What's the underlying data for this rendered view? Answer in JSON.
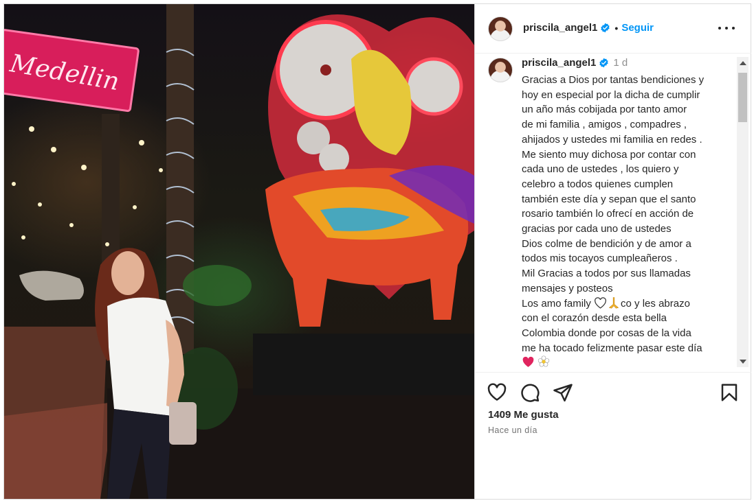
{
  "post": {
    "username": "priscila_angel1",
    "follow_label": "Seguir",
    "separator": "•",
    "photo_sign_text": "Medellin"
  },
  "caption": {
    "username": "priscila_angel1",
    "time": "1 d",
    "lines": [
      "Gracias a Dios por tantas bendiciones y",
      "hoy en especial por la dicha de cumplir",
      "un año más cobijada por tanto amor",
      "de mi familia , amigos , compadres ,",
      "ahijados y ustedes mi familia en redes .",
      "Me siento muy dichosa por contar con",
      "cada uno de ustedes , los quiero y",
      "celebro a todos quienes cumplen",
      "también este día y sepan que el santo",
      "rosario también lo ofrecí en acción de",
      "gracias por cada uno de ustedes",
      "Dios colme de bendición y de amor a",
      "todos mis tocayos cumpleañeros .",
      "Mil Gracias a todos por sus llamadas",
      "mensajes y posteos"
    ],
    "line_family_prefix": "Los amo family",
    "line_family_suffix": "co y les abrazo",
    "lines_end": [
      "con el corazón desde esta bella",
      "Colombia donde por cosas de la vida",
      "me ha tocado felizmente pasar este día"
    ],
    "emojis": [
      "white-heart",
      "folded-hands",
      "red-heart",
      "flower"
    ]
  },
  "stats": {
    "likes": "1409 Me gusta",
    "posted": "Hace un día"
  },
  "icons": {
    "verified": "verified-badge-icon",
    "like": "heart-icon",
    "comment": "comment-icon",
    "share": "share-icon",
    "save": "bookmark-icon",
    "more": "more-options-icon"
  },
  "colors": {
    "accent": "#0095f6",
    "text": "#262626",
    "muted": "#8e8e8e",
    "heart_red": "#e0245e"
  }
}
